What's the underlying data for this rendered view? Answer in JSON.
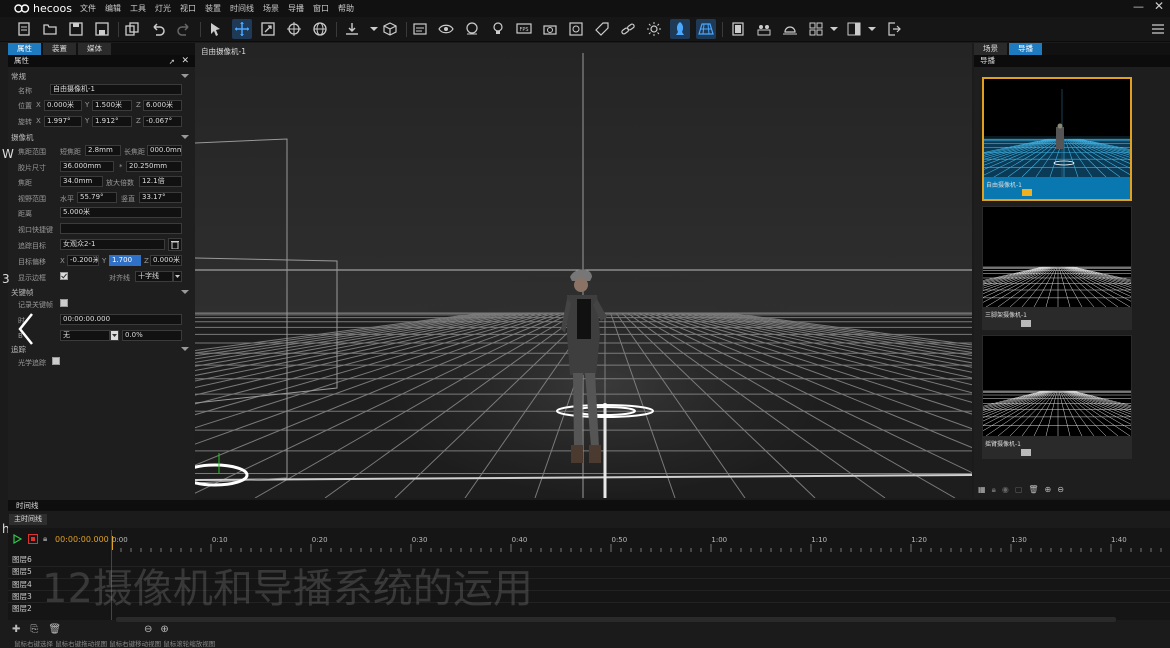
{
  "app": {
    "name": "hecoos"
  },
  "menu": [
    "文件",
    "编辑",
    "工具",
    "灯光",
    "视口",
    "装置",
    "时间线",
    "场景",
    "导播",
    "窗口",
    "帮助"
  ],
  "toolbar_icons": [
    "new-file-icon",
    "open-folder-icon",
    "save-icon",
    "save-as-icon",
    "undo-icon",
    "redo-icon",
    "select-arrow-icon",
    "move-icon",
    "scale-icon",
    "rotate-icon",
    "globe-icon",
    "import-icon",
    "cube-icon",
    "text-box-icon",
    "eye-icon",
    "face-icon",
    "lightbulb-icon",
    "fps-icon",
    "camera-icon",
    "capture-icon",
    "tag-icon",
    "link-icon",
    "sun-icon",
    "rocket-icon",
    "grid-icon",
    "film-icon",
    "group-icon",
    "sunset-icon",
    "layout-icon",
    "panel-icon",
    "exit-icon"
  ],
  "left_panel": {
    "tabs": [
      "属性",
      "装置",
      "媒体"
    ],
    "subheader": "属性",
    "sections": {
      "general": "常规",
      "camera": "摄像机",
      "keyframe": "关键帧",
      "tracking": "追踪"
    },
    "labels": {
      "name": "名称",
      "position": "位置",
      "rotation": "旋转",
      "focal_range": "焦距范围",
      "short": "短焦距",
      "long": "长焦距",
      "film_size": "胶片尺寸",
      "focal": "焦距",
      "zoom": "放大倍数",
      "fov": "视野范围",
      "horizontal": "水平",
      "vertical": "竖直",
      "distance": "距离",
      "viewport_shortcut": "视口快捷键",
      "track_target": "追踪目标",
      "target_offset": "目标偏移",
      "show_frame": "显示边框",
      "align": "对齐线",
      "record_keyframe": "记录关键帧",
      "time": "时",
      "optical_tracking": "光学追踪",
      "x": "X",
      "y": "Y",
      "z": "Z",
      "star": "*"
    },
    "values": {
      "name": "自由摄像机-1",
      "pos_x": "0.000米",
      "pos_y": "1.500米",
      "pos_z": "6.000米",
      "rot_x": "1.997°",
      "rot_y": "1.912°",
      "rot_z": "-0.067°",
      "short_focal": "2.8mm",
      "long_focal": "000.0mm",
      "film_w": "36.000mm",
      "film_h": "20.250mm",
      "focal": "34.0mm",
      "zoom": "12.1倍",
      "fov_h": "55.79°",
      "fov_v": "33.17°",
      "distance": "5.000米",
      "viewport_shortcut": "",
      "track_target": "女观众2-1",
      "off_x": "-0.200米",
      "off_y": "1.700",
      "off_z": "0.000米",
      "align": "十字线",
      "keyframe_time": "00:00:00.000",
      "curve": "无",
      "percent": "0.0%",
      "curve_prefix": "B"
    }
  },
  "viewport": {
    "title": "自由摄像机-1"
  },
  "right_panel": {
    "tabs": [
      "场景",
      "导播"
    ],
    "subheader": "导播",
    "cameras": [
      "自由摄像机-1",
      "三脚架摄像机-1",
      "摇臂摄像机-1"
    ]
  },
  "timeline": {
    "header": "时间线",
    "tab": "主时间线",
    "timecode": "00:00:00.000",
    "ruler": [
      "0:00",
      "0:10",
      "0:20",
      "0:30",
      "0:40",
      "0:50",
      "1:00",
      "1:10",
      "1:20",
      "1:30",
      "1:40"
    ],
    "layers": [
      "图层6",
      "图层5",
      "图层4",
      "图层3",
      "图层2"
    ],
    "footer": "鼠标右键选择 鼠标右键拖动视图 鼠标右键移动视图 鼠标滚轮缩放视图"
  },
  "overlay": {
    "watermark": "12摄像机和导播系统的运用",
    "left_glyph_1": "W",
    "left_glyph_2": "3",
    "left_glyph_3": "h"
  },
  "colors": {
    "accent": "#1f7bc0",
    "selected_border": "#e0a020",
    "thumb_selected_bg": "#0a78b0"
  }
}
